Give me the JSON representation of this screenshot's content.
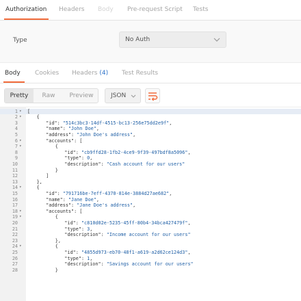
{
  "request_tabs": [
    {
      "label": "Authorization",
      "active": true
    },
    {
      "label": "Headers",
      "active": false
    },
    {
      "label": "Body",
      "active": false
    },
    {
      "label": "Pre-request Script",
      "active": false
    },
    {
      "label": "Tests",
      "active": false
    }
  ],
  "auth": {
    "type_label": "Type",
    "type_value": "No Auth"
  },
  "response_tabs": [
    {
      "label": "Body",
      "active": true
    },
    {
      "label": "Cookies",
      "active": false
    },
    {
      "label": "Headers",
      "count": "(4)",
      "active": false
    },
    {
      "label": "Test Results",
      "active": false
    }
  ],
  "format": {
    "pretty": "Pretty",
    "raw": "Raw",
    "preview": "Preview",
    "language": "JSON"
  },
  "colors": {
    "accent": "#f26b3a",
    "count_blue": "#2f73c8",
    "string_blue": "#1f5fa6"
  },
  "code_lines": [
    {
      "n": "1",
      "fold": true,
      "indent": 0,
      "parts": [
        [
          "p",
          "["
        ]
      ],
      "hl": true
    },
    {
      "n": "2",
      "fold": true,
      "indent": 1,
      "parts": [
        [
          "p",
          "{"
        ]
      ]
    },
    {
      "n": "3",
      "indent": 2,
      "parts": [
        [
          "k",
          "\"id\""
        ],
        [
          "p",
          ": "
        ],
        [
          "s",
          "\"514c3bc3-14df-4515-bc13-256e75dd2e9f\""
        ],
        [
          "p",
          ","
        ]
      ]
    },
    {
      "n": "4",
      "indent": 2,
      "parts": [
        [
          "k",
          "\"name\""
        ],
        [
          "p",
          ": "
        ],
        [
          "s",
          "\"John Doe\""
        ],
        [
          "p",
          ","
        ]
      ]
    },
    {
      "n": "5",
      "indent": 2,
      "parts": [
        [
          "k",
          "\"address\""
        ],
        [
          "p",
          ": "
        ],
        [
          "s",
          "\"John Doe's address\""
        ],
        [
          "p",
          ","
        ]
      ]
    },
    {
      "n": "6",
      "fold": true,
      "indent": 2,
      "parts": [
        [
          "k",
          "\"accounts\""
        ],
        [
          "p",
          ": ["
        ]
      ]
    },
    {
      "n": "7",
      "fold": true,
      "indent": 3,
      "parts": [
        [
          "p",
          "{"
        ]
      ]
    },
    {
      "n": "8",
      "indent": 4,
      "parts": [
        [
          "k",
          "\"id\""
        ],
        [
          "p",
          ": "
        ],
        [
          "s",
          "\"cb9ffd28-1fb2-4ce9-9f39-497bdf8a5096\""
        ],
        [
          "p",
          ","
        ]
      ]
    },
    {
      "n": "9",
      "indent": 4,
      "parts": [
        [
          "k",
          "\"type\""
        ],
        [
          "p",
          ": "
        ],
        [
          "n",
          "0"
        ],
        [
          "p",
          ","
        ]
      ]
    },
    {
      "n": "10",
      "indent": 4,
      "parts": [
        [
          "k",
          "\"description\""
        ],
        [
          "p",
          ": "
        ],
        [
          "s",
          "\"Cash account for our users\""
        ]
      ]
    },
    {
      "n": "11",
      "indent": 3,
      "parts": [
        [
          "p",
          "}"
        ]
      ]
    },
    {
      "n": "12",
      "indent": 2,
      "parts": [
        [
          "p",
          "]"
        ]
      ]
    },
    {
      "n": "13",
      "indent": 1,
      "parts": [
        [
          "p",
          "},"
        ]
      ]
    },
    {
      "n": "14",
      "fold": true,
      "indent": 1,
      "parts": [
        [
          "p",
          "{"
        ]
      ]
    },
    {
      "n": "15",
      "indent": 2,
      "parts": [
        [
          "k",
          "\"id\""
        ],
        [
          "p",
          ": "
        ],
        [
          "s",
          "\"791716be-7eff-4370-814e-3884d27ae682\""
        ],
        [
          "p",
          ","
        ]
      ]
    },
    {
      "n": "16",
      "indent": 2,
      "parts": [
        [
          "k",
          "\"name\""
        ],
        [
          "p",
          ": "
        ],
        [
          "s",
          "\"Jane Doe\""
        ],
        [
          "p",
          ","
        ]
      ]
    },
    {
      "n": "17",
      "indent": 2,
      "parts": [
        [
          "k",
          "\"address\""
        ],
        [
          "p",
          ": "
        ],
        [
          "s",
          "\"Jane Doe's address\""
        ],
        [
          "p",
          ","
        ]
      ]
    },
    {
      "n": "18",
      "fold": true,
      "indent": 2,
      "parts": [
        [
          "k",
          "\"accounts\""
        ],
        [
          "p",
          ": ["
        ]
      ]
    },
    {
      "n": "19",
      "fold": true,
      "indent": 3,
      "parts": [
        [
          "p",
          "{"
        ]
      ]
    },
    {
      "n": "20",
      "indent": 4,
      "parts": [
        [
          "k",
          "\"id\""
        ],
        [
          "p",
          ": "
        ],
        [
          "s",
          "\"c810d02e-5235-45ff-80b4-34bca427479f\""
        ],
        [
          "p",
          ","
        ]
      ]
    },
    {
      "n": "21",
      "indent": 4,
      "parts": [
        [
          "k",
          "\"type\""
        ],
        [
          "p",
          ": "
        ],
        [
          "n",
          "3"
        ],
        [
          "p",
          ","
        ]
      ]
    },
    {
      "n": "22",
      "indent": 4,
      "parts": [
        [
          "k",
          "\"description\""
        ],
        [
          "p",
          ": "
        ],
        [
          "s",
          "\"Income account for our users\""
        ]
      ]
    },
    {
      "n": "23",
      "indent": 3,
      "parts": [
        [
          "p",
          "},"
        ]
      ]
    },
    {
      "n": "24",
      "fold": true,
      "indent": 3,
      "parts": [
        [
          "p",
          "{"
        ]
      ]
    },
    {
      "n": "25",
      "indent": 4,
      "parts": [
        [
          "k",
          "\"id\""
        ],
        [
          "p",
          ": "
        ],
        [
          "s",
          "\"4855d973-eb70-48f1-a619-a2d62ce124d3\""
        ],
        [
          "p",
          ","
        ]
      ]
    },
    {
      "n": "26",
      "indent": 4,
      "parts": [
        [
          "k",
          "\"type\""
        ],
        [
          "p",
          ": "
        ],
        [
          "n",
          "1"
        ],
        [
          "p",
          ","
        ]
      ]
    },
    {
      "n": "27",
      "indent": 4,
      "parts": [
        [
          "k",
          "\"description\""
        ],
        [
          "p",
          ": "
        ],
        [
          "s",
          "\"Savings account for our users\""
        ]
      ]
    },
    {
      "n": "28",
      "indent": 3,
      "parts": [
        [
          "p",
          "}"
        ]
      ]
    }
  ]
}
